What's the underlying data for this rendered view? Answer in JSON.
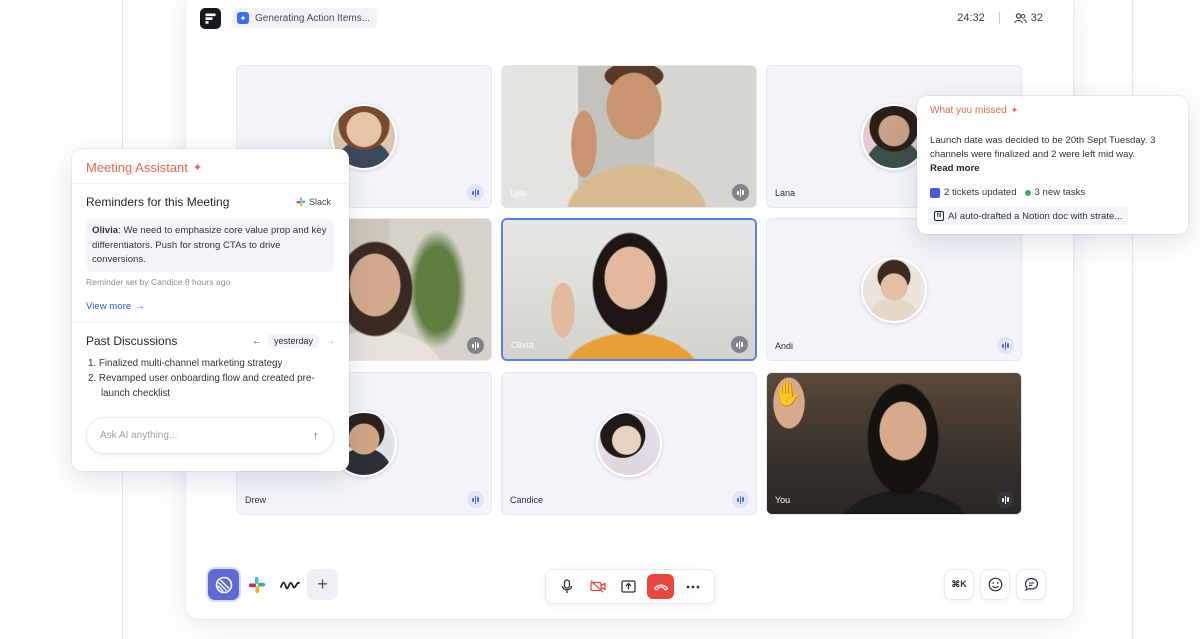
{
  "topbar": {
    "status_chip": "Generating Action Items...",
    "timer": "24:32",
    "participant_count": "32"
  },
  "participants": [
    {
      "name": "",
      "type": "avatar"
    },
    {
      "name": "Lyle",
      "type": "video"
    },
    {
      "name": "Lana",
      "type": "avatar"
    },
    {
      "name": "",
      "type": "video"
    },
    {
      "name": "Olivia",
      "type": "video",
      "active": true
    },
    {
      "name": "Andi",
      "type": "avatar"
    },
    {
      "name": "Drew",
      "type": "avatar"
    },
    {
      "name": "Candice",
      "type": "avatar"
    },
    {
      "name": "You",
      "type": "video"
    }
  ],
  "assistant": {
    "title": "Meeting Assistant",
    "reminders_title": "Reminders for this Meeting",
    "reminder_source": "Slack",
    "reminder_author": "Olivia",
    "reminder_text": ": We need to emphasize core value prop and key differentiators. Push for strong CTAs to drive conversions.",
    "reminder_meta": "Reminder set by Candice 8 hours ago",
    "view_more": "View more",
    "past_title": "Past Discussions",
    "past_period": "yesterday",
    "past_items": [
      "1. Finalized multi-channel marketing strategy",
      "2. Revamped user onboarding flow and created pre-launch checklist"
    ],
    "ask_placeholder": "Ask AI anything..."
  },
  "missed": {
    "title": "What you missed",
    "summary": "Launch date was decided to be 20th Sept Tuesday. 3 channels were finalized and 2 were left mid way.",
    "read_more": "Read more",
    "tickets": "2 tickets updated",
    "tasks": "3 new tasks",
    "notion": "AI auto-drafted a Notion doc with strate..."
  },
  "toolbar": {
    "shortcut": "⌘K"
  },
  "colors": {
    "accent_orange": "#e5674a",
    "link_blue": "#2e5ad6",
    "end_call_red": "#e8473e",
    "linear_purple": "#5e6ad2"
  }
}
